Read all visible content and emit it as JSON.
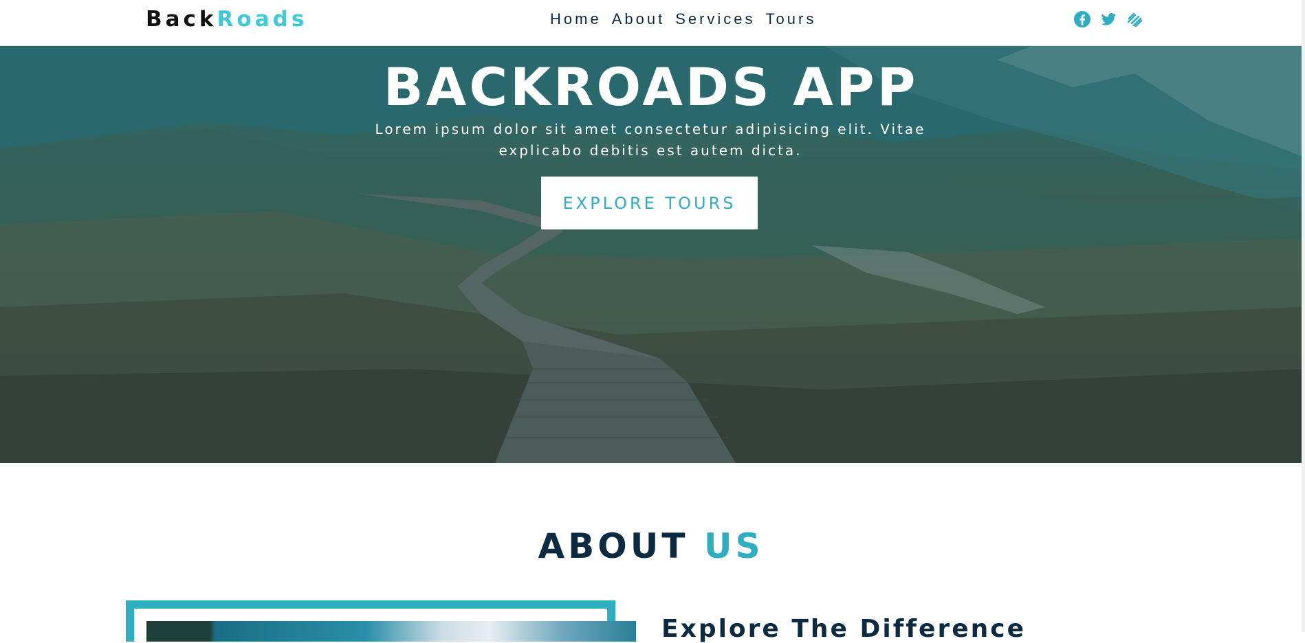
{
  "navbar": {
    "logo_part1": "Back",
    "logo_part2": "Roads",
    "links": [
      "Home",
      "About",
      "Services",
      "Tours"
    ],
    "social_icons": [
      "facebook-icon",
      "twitter-icon",
      "squarespace-icon"
    ]
  },
  "hero": {
    "title": "BACKROADS APP",
    "text": "Lorem ipsum dolor sit amet consectetur adipisicing elit. Vitae explicabo debitis est autem dicta.",
    "button_label": "EXPLORE TOURS"
  },
  "about": {
    "title_part1": "ABOUT",
    "title_part2": "US",
    "heading": "Explore The Difference"
  },
  "colors": {
    "accent": "#2eaebe",
    "logo_accent": "#3ec9d6",
    "dark": "#0c2b40",
    "white": "#ffffff"
  }
}
